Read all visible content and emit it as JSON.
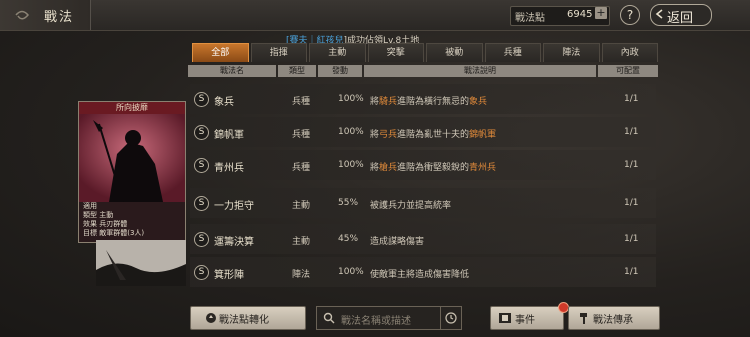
{
  "header": {
    "title": "戰法",
    "points_label": "戰法點",
    "points_value": "6945",
    "plus": "+",
    "help": "?",
    "back_label": "返回"
  },
  "subtitle": {
    "prefix": "[賽夫｜",
    "player": "紅孩兒",
    "suffix": "]成功佔領Lv.8土地"
  },
  "tabs": [
    "全部",
    "指揮",
    "主動",
    "突擊",
    "被動",
    "兵種",
    "陣法",
    "內政"
  ],
  "columns": {
    "name": "戰法名",
    "type": "類型",
    "rate": "發動",
    "desc": "戰法說明",
    "cfg": "可配置"
  },
  "rows": [
    {
      "name": "象兵",
      "type": "兵種",
      "rate": "100%",
      "desc_pre": "將",
      "desc_hl1": "騎兵",
      "desc_mid": "進階為橫行無忌的",
      "desc_hl2": "象兵",
      "cfg": "1/1"
    },
    {
      "name": "錦帆軍",
      "type": "兵種",
      "rate": "100%",
      "desc_pre": "將",
      "desc_hl1": "弓兵",
      "desc_mid": "進階為亂世十夫的",
      "desc_hl2": "錦帆軍",
      "cfg": "1/1"
    },
    {
      "name": "青州兵",
      "type": "兵種",
      "rate": "100%",
      "desc_pre": "將",
      "desc_hl1": "槍兵",
      "desc_mid": "進階為衝堅毅銳的",
      "desc_hl2": "青州兵",
      "cfg": "1/1"
    },
    {
      "name": "一力拒守",
      "type": "主動",
      "rate": "55%",
      "desc_pre": "",
      "desc_hl1": "",
      "desc_mid": "被護兵力並提高統率",
      "desc_hl2": "",
      "cfg": "1/1"
    },
    {
      "name": "運籌決算",
      "type": "主動",
      "rate": "45%",
      "desc_pre": "",
      "desc_hl1": "",
      "desc_mid": "造成謀略傷害",
      "desc_hl2": "",
      "cfg": "1/1"
    },
    {
      "name": "箕形陣",
      "type": "陣法",
      "rate": "100%",
      "desc_pre": "",
      "desc_hl1": "",
      "desc_mid": "使敵軍主將造成傷害降低",
      "desc_hl2": "",
      "cfg": "1/1"
    }
  ],
  "card": {
    "title": "所向披靡",
    "lines": [
      "適用",
      "類型  主動",
      "效果  兵刃群體",
      "目標  敵軍群體(3人)"
    ]
  },
  "bottom": {
    "convert_label": "戰法點轉化",
    "search_placeholder": "戰法名稱或描述",
    "event_label": "事件",
    "inherit_label": "戰法傳承"
  }
}
